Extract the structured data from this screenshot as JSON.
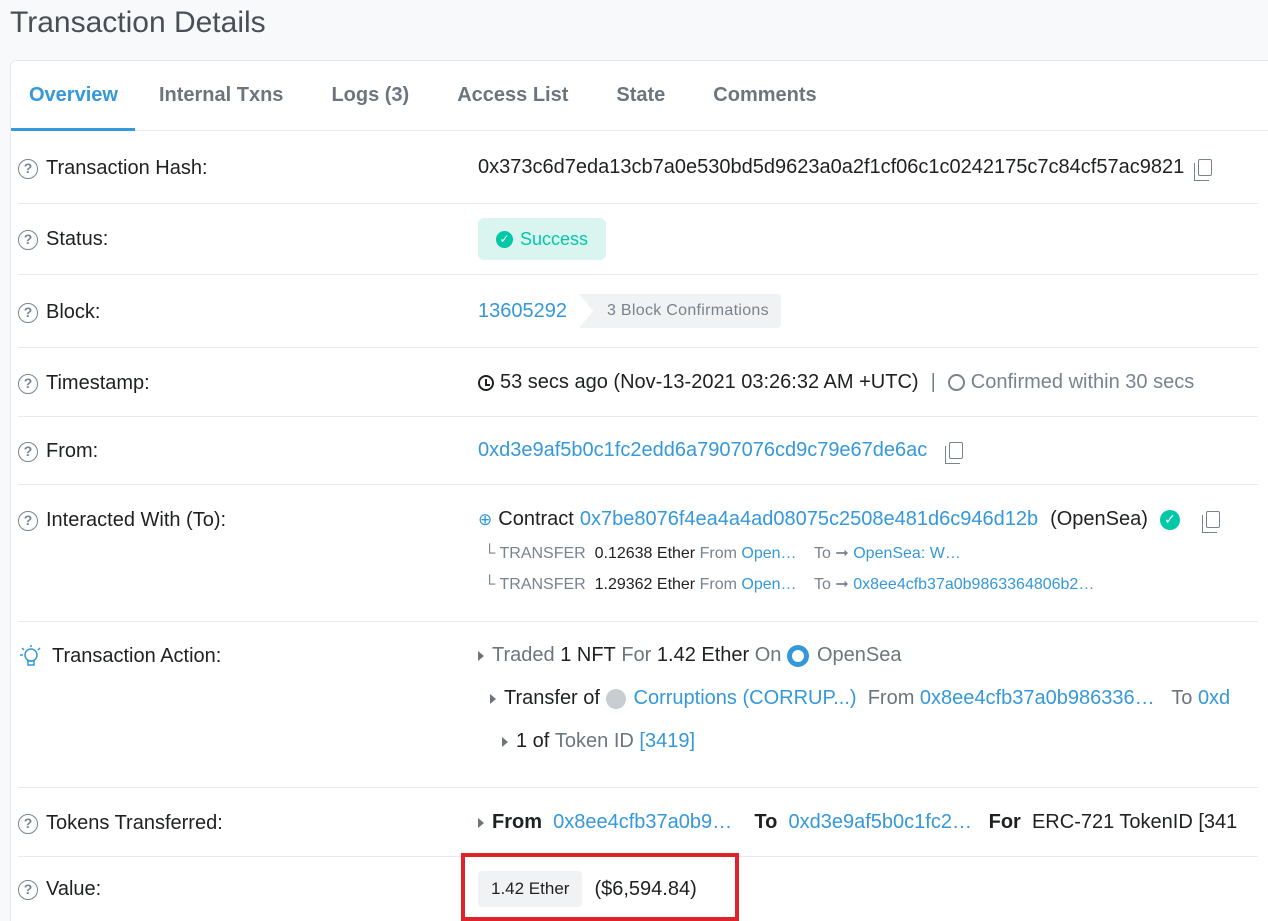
{
  "page": {
    "title": "Transaction Details"
  },
  "tabs": [
    "Overview",
    "Internal Txns",
    "Logs (3)",
    "Access List",
    "State",
    "Comments"
  ],
  "rows": {
    "hash": {
      "label": "Transaction Hash:",
      "value": "0x373c6d7eda13cb7a0e530bd5d9623a0a2f1cf06c1c0242175c7c84cf57ac9821"
    },
    "status": {
      "label": "Status:",
      "value": "Success"
    },
    "block": {
      "label": "Block:",
      "number": "13605292",
      "confirmations": "3 Block Confirmations"
    },
    "timestamp": {
      "label": "Timestamp:",
      "value": "53 secs ago (Nov-13-2021 03:26:32 AM +UTC)",
      "separator": "|",
      "confirmed": "Confirmed within 30 secs"
    },
    "from": {
      "label": "From:",
      "value": "0xd3e9af5b0c1fc2edd6a7907076cd9c79e67de6ac"
    },
    "to": {
      "label": "Interacted With (To):",
      "prefix": "Contract",
      "address": "0x7be8076f4ea4a4ad08075c2508e481d6c946d12b",
      "name": "(OpenSea)",
      "transfers": [
        {
          "kind": "└ TRANSFER",
          "amount": "0.12638 Ether",
          "from_label": "From",
          "from": "Open…",
          "to_label": "To ➞",
          "to": "OpenSea: W…"
        },
        {
          "kind": "└ TRANSFER",
          "amount": "1.29362 Ether",
          "from_label": "From",
          "from": "Open…",
          "to_label": "To ➞",
          "to": "0x8ee4cfb37a0b9863364806b2…"
        }
      ]
    },
    "action": {
      "label": "Transaction Action:",
      "line1": {
        "a": "Traded",
        "b": "1 NFT",
        "c": "For",
        "d": "1.42 Ether",
        "e": "On",
        "f": "OpenSea"
      },
      "line2": {
        "a": "Transfer of",
        "b": "Corruptions (CORRUP...)",
        "c": "From",
        "d": "0x8ee4cfb37a0b986336…",
        "e": "To",
        "f": "0xd"
      },
      "line3": {
        "a": "1 of",
        "b": "Token ID",
        "c": "[3419]"
      }
    },
    "tokens": {
      "label": "Tokens Transferred:",
      "from_label": "From",
      "from": "0x8ee4cfb37a0b9…",
      "to_label": "To",
      "to": "0xd3e9af5b0c1fc2…",
      "for_label": "For",
      "for": "ERC-721 TokenID [341"
    },
    "value": {
      "label": "Value:",
      "ether": "1.42 Ether",
      "usd": "($6,594.84)"
    }
  }
}
